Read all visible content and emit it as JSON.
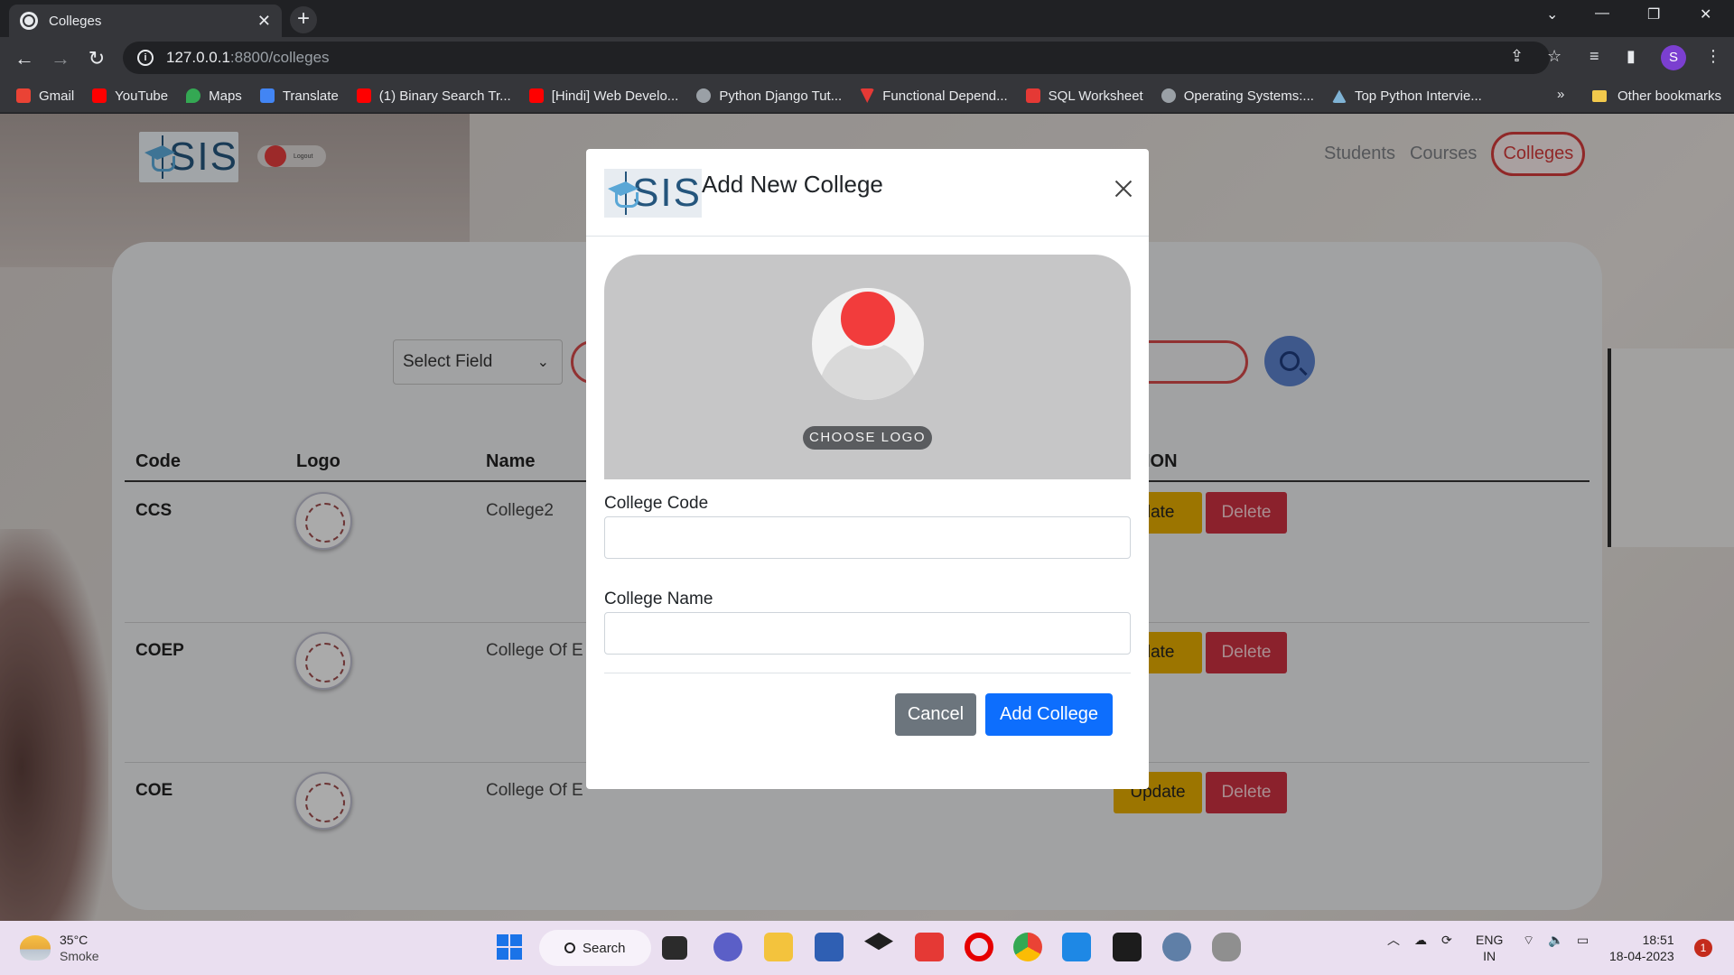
{
  "browser": {
    "tab_title": "Colleges",
    "url_host": "127.0.0.1",
    "url_path": ":8800/colleges",
    "profile_initial": "S",
    "bookmarks": [
      {
        "label": "Gmail",
        "color": "#ea4335"
      },
      {
        "label": "YouTube",
        "color": "#ff0000"
      },
      {
        "label": "Maps",
        "color": "#34a853"
      },
      {
        "label": "Translate",
        "color": "#4285f4"
      },
      {
        "label": "(1) Binary Search Tr...",
        "color": "#ff0000"
      },
      {
        "label": "[Hindi] Web Develo...",
        "color": "#ff0000"
      },
      {
        "label": "Python Django Tut...",
        "color": "#9aa0a6"
      },
      {
        "label": "Functional Depend...",
        "color": "#e53935"
      },
      {
        "label": "SQL Worksheet",
        "color": "#e53935"
      },
      {
        "label": "Operating Systems:...",
        "color": "#9aa0a6"
      },
      {
        "label": "Top Python Intervie...",
        "color": "#7fb3d5"
      }
    ],
    "bookmarks_more": "»",
    "other_bookmarks": "Other bookmarks"
  },
  "app": {
    "brand": "SIS",
    "logout_label": "Logout",
    "nav": [
      "Students",
      "Courses",
      "Colleges"
    ],
    "select_field": "Select Field",
    "table_headers": [
      "Code",
      "Logo",
      "Name",
      "ION"
    ],
    "rows": [
      {
        "code": "CCS",
        "name": "College2",
        "update": "date",
        "delete": "Delete"
      },
      {
        "code": "COEP",
        "name": "College Of E",
        "update": "date",
        "delete": "Delete"
      },
      {
        "code": "COE",
        "name": "College Of E",
        "update": "Update",
        "delete": "Delete"
      }
    ]
  },
  "modal": {
    "brand": "SIS",
    "title": "Add New College",
    "choose_logo": "CHOOSE LOGO",
    "code_label": "College Code",
    "code_value": "",
    "name_label": "College Name",
    "name_value": "",
    "cancel": "Cancel",
    "submit": "Add College"
  },
  "taskbar": {
    "temperature": "35°C",
    "condition": "Smoke",
    "search_label": "Search",
    "language": "ENG",
    "region": "IN",
    "time": "18:51",
    "date": "18-04-2023",
    "notifications": "1"
  }
}
